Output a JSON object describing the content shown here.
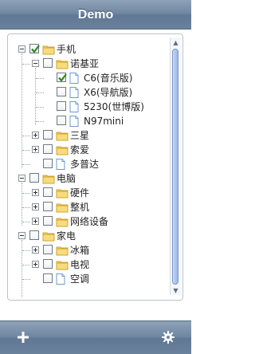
{
  "app": {
    "title": "Demo"
  },
  "tree": [
    {
      "label": "手机",
      "level": 0,
      "expander": "minus",
      "checked": true,
      "icon": "folder-open-icon"
    },
    {
      "label": "诺基亚",
      "level": 1,
      "expander": "minus",
      "checked": false,
      "icon": "folder-open-icon"
    },
    {
      "label": "C6(音乐版)",
      "level": 2,
      "expander": "none",
      "checked": true,
      "icon": "document-icon"
    },
    {
      "label": "X6(导航版)",
      "level": 2,
      "expander": "none",
      "checked": false,
      "icon": "document-icon"
    },
    {
      "label": "5230(世博版)",
      "level": 2,
      "expander": "none",
      "checked": false,
      "icon": "document-icon"
    },
    {
      "label": "N97mini",
      "level": 2,
      "expander": "none",
      "checked": false,
      "icon": "document-icon"
    },
    {
      "label": "三星",
      "level": 1,
      "expander": "plus",
      "checked": false,
      "icon": "folder-icon"
    },
    {
      "label": "索爱",
      "level": 1,
      "expander": "plus",
      "checked": false,
      "icon": "folder-icon"
    },
    {
      "label": "多普达",
      "level": 1,
      "expander": "none",
      "checked": false,
      "icon": "document-icon"
    },
    {
      "label": "电脑",
      "level": 0,
      "expander": "minus",
      "checked": false,
      "icon": "folder-open-icon"
    },
    {
      "label": "硬件",
      "level": 1,
      "expander": "plus",
      "checked": false,
      "icon": "folder-icon"
    },
    {
      "label": "整机",
      "level": 1,
      "expander": "plus",
      "checked": false,
      "icon": "folder-icon"
    },
    {
      "label": "网络设备",
      "level": 1,
      "expander": "plus",
      "checked": false,
      "icon": "folder-icon"
    },
    {
      "label": "家电",
      "level": 0,
      "expander": "minus",
      "checked": false,
      "icon": "folder-open-icon"
    },
    {
      "label": "冰箱",
      "level": 1,
      "expander": "plus",
      "checked": false,
      "icon": "folder-icon"
    },
    {
      "label": "电视",
      "level": 1,
      "expander": "plus",
      "checked": false,
      "icon": "folder-icon"
    },
    {
      "label": "空调",
      "level": 1,
      "expander": "none",
      "checked": false,
      "icon": "document-icon"
    }
  ],
  "toolbar": {
    "add_icon": "plus-icon",
    "settings_icon": "gear-icon"
  },
  "colors": {
    "bar_top": "#8fa3b9",
    "bar_bottom": "#6a819c",
    "folder": "#f3cf63",
    "check": "#2b8a22"
  }
}
